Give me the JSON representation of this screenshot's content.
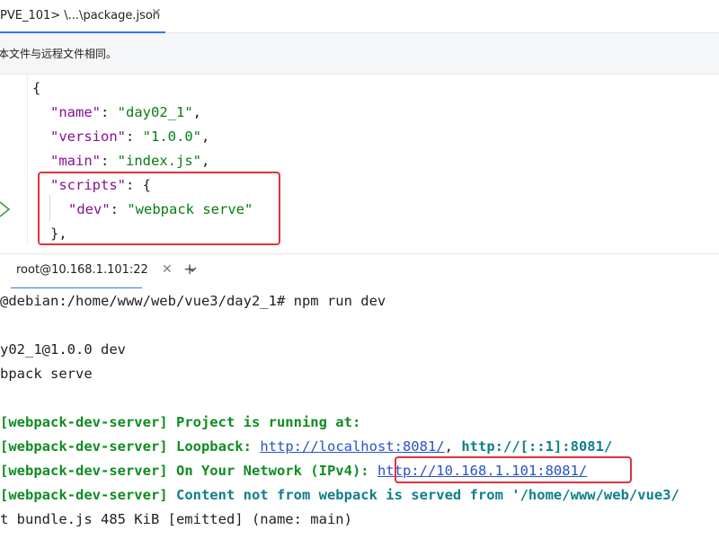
{
  "editor_tab": {
    "label": "PVE_101> \\...\\package.json",
    "close": "✕"
  },
  "notice": {
    "text": "本文件与远程文件相同。"
  },
  "code": {
    "open_brace": "{",
    "name_key": "\"name\"",
    "name_val": "\"day02_1\"",
    "version_key": "\"version\"",
    "version_val": "\"1.0.0\"",
    "main_key": "\"main\"",
    "main_val": "\"index.js\"",
    "scripts_key": "\"scripts\"",
    "scripts_open": "{",
    "dev_key": "\"dev\"",
    "dev_val": "\"webpack serve\"",
    "scripts_close": "},"
  },
  "terminal_tab": {
    "label": "root@10.168.1.101:22",
    "close": "✕",
    "plus": "+"
  },
  "terminal": {
    "prompt": "@debian:/home/www/web/vue3/day2_1# npm run dev",
    "script_name": "y02_1@1.0.0 dev",
    "script_cmd": "bpack serve",
    "wds_prefix": "[webpack-dev-server]",
    "running_text": "Project is running at:",
    "loopback_label": "Loopback:",
    "loopback_url1": "http://localhost:8081/",
    "loopback_sep": ",",
    "loopback_url2": "http://[::1]:8081/",
    "network_label": "On Your Network (IPv4):",
    "network_url": "http://10.168.1.101:8081/",
    "content_text": "Content not from webpack is served from '/home/www/web/vue3/",
    "asset_line": "t bundle.js 485 KiB [emitted] (name: main)"
  },
  "colors": {
    "accent": "#3574f0",
    "highlight_box": "#e0333b",
    "string": "#067d17",
    "key": "#871094",
    "terminal_green": "#108c22"
  }
}
